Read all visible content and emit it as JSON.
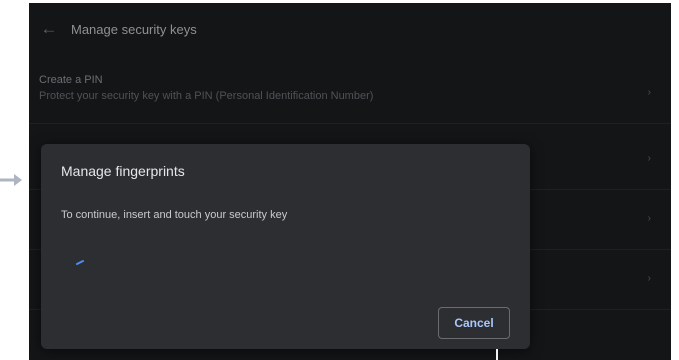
{
  "app": {
    "title": "Manage security keys"
  },
  "settings_rows": [
    {
      "title": "Create a PIN",
      "subtitle": "Protect your security key with a PIN (Personal Identification Number)"
    },
    {
      "title": "",
      "subtitle": ""
    },
    {
      "title": "",
      "subtitle": ""
    },
    {
      "title": "",
      "subtitle": ""
    }
  ],
  "dialog": {
    "title": "Manage fingerprints",
    "message": "To continue, insert and touch your security key",
    "cancel_label": "Cancel"
  },
  "icons": {
    "back": "back-arrow-icon",
    "chevron": "chevron-right-icon",
    "spinner": "loading-spinner-icon",
    "pointer": "pointer-arrow-icon"
  },
  "colors": {
    "background": "#141517",
    "dialog": "#2c2e32",
    "accent": "#a8c7fa"
  }
}
